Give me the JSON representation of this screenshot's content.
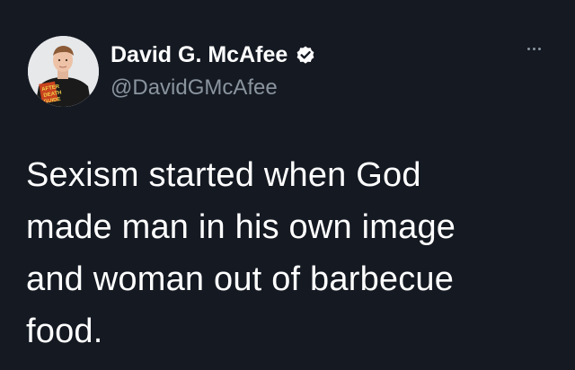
{
  "tweet": {
    "author": {
      "display_name": "David G. McAfee",
      "handle": "@DavidGMcAfee",
      "verified": true,
      "avatar_icon": "profile-photo"
    },
    "more_icon": "more-horizontal-icon",
    "text_lines": [
      "Sexism started when God",
      "made man in his own image",
      "and woman out of barbecue",
      "food."
    ]
  },
  "colors": {
    "background": "#141922",
    "text_primary": "#ffffff",
    "text_secondary": "#8a949e",
    "verified_badge": "#ffffff"
  }
}
